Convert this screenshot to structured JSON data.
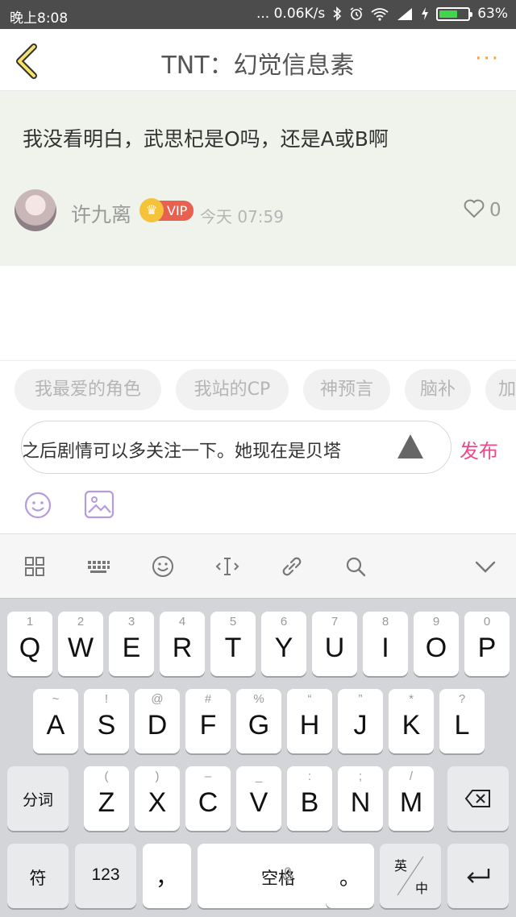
{
  "status_bar": {
    "time": "晚上8:08",
    "network_speed": "... 0.06K/s",
    "battery_percent": "63%",
    "battery_level": 0.63,
    "icons": [
      "bluetooth-icon",
      "alarm-icon",
      "wifi-icon",
      "signal-icon",
      "charging-icon",
      "battery-icon"
    ]
  },
  "header": {
    "title": "TNT：幻觉信息素",
    "more": "···",
    "accent_color": "#f0a04b"
  },
  "post": {
    "text": "我没看明白，武思杞是O吗，还是A或B啊",
    "author": "许九离",
    "vip": "VIP",
    "time": "今天 07:59",
    "likes": "0"
  },
  "tags": [
    {
      "label": "我最爱的角色"
    },
    {
      "label": "我站的CP"
    },
    {
      "label": "神预言"
    },
    {
      "label": "脑补"
    },
    {
      "label": "加"
    }
  ],
  "comment": {
    "value": "之后剧情可以多关注一下。她现在是贝塔",
    "publish_label": "发布",
    "publish_color": "#e84c8a"
  },
  "keyboard": {
    "row1": [
      {
        "hint": "1",
        "key": "Q"
      },
      {
        "hint": "2",
        "key": "W"
      },
      {
        "hint": "3",
        "key": "E"
      },
      {
        "hint": "4",
        "key": "R"
      },
      {
        "hint": "5",
        "key": "T"
      },
      {
        "hint": "6",
        "key": "Y"
      },
      {
        "hint": "7",
        "key": "U"
      },
      {
        "hint": "8",
        "key": "I"
      },
      {
        "hint": "9",
        "key": "O"
      },
      {
        "hint": "0",
        "key": "P"
      }
    ],
    "row2": [
      {
        "hint": "~",
        "key": "A"
      },
      {
        "hint": "!",
        "key": "S"
      },
      {
        "hint": "@",
        "key": "D"
      },
      {
        "hint": "#",
        "key": "F"
      },
      {
        "hint": "%",
        "key": "G"
      },
      {
        "hint": "“",
        "key": "H"
      },
      {
        "hint": "”",
        "key": "J"
      },
      {
        "hint": "*",
        "key": "K"
      },
      {
        "hint": "?",
        "key": "L"
      }
    ],
    "row3": [
      {
        "hint": "(",
        "key": "Z"
      },
      {
        "hint": ")",
        "key": "X"
      },
      {
        "hint": "–",
        "key": "C"
      },
      {
        "hint": "_",
        "key": "V"
      },
      {
        "hint": ":",
        "key": "B"
      },
      {
        "hint": ";",
        "key": "N"
      },
      {
        "hint": "/",
        "key": "M"
      }
    ],
    "fenci": "分词",
    "symbol": "符",
    "num": "123",
    "comma": "，",
    "space": "空格",
    "period": "。",
    "lang_top": "英",
    "lang_bottom": "中"
  }
}
